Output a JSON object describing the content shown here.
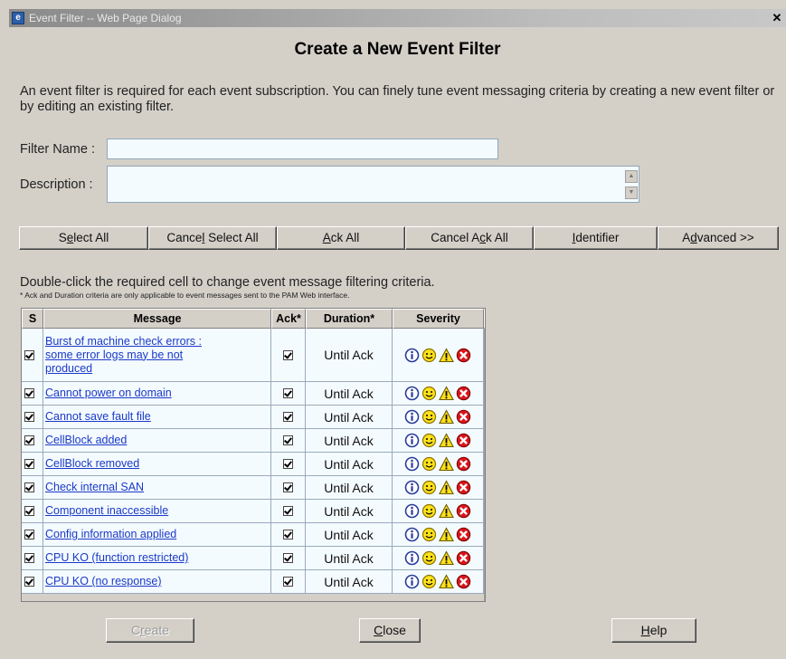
{
  "window": {
    "title": "Event Filter -- Web Page Dialog",
    "close_glyph": "✕"
  },
  "page": {
    "heading": "Create a New Event Filter",
    "intro": "An event filter is required for each event subscription. You can finely tune event messaging criteria by creating a new event filter or by editing an existing filter."
  },
  "form": {
    "filter_name_label": "Filter Name :",
    "filter_name_value": "",
    "description_label": "Description :",
    "description_value": ""
  },
  "toolbar": [
    {
      "pre": "S",
      "key": "e",
      "post": "lect All",
      "name": "select-all-button"
    },
    {
      "pre": "Cance",
      "key": "l",
      "post": " Select All",
      "name": "cancel-select-all-button"
    },
    {
      "pre": "",
      "key": "A",
      "post": "ck All",
      "name": "ack-all-button"
    },
    {
      "pre": "Cancel A",
      "key": "c",
      "post": "k All",
      "name": "cancel-ack-all-button"
    },
    {
      "pre": "",
      "key": "I",
      "post": "dentifier",
      "name": "identifier-button"
    },
    {
      "pre": "A",
      "key": "d",
      "post": "vanced >>",
      "name": "advanced-button"
    }
  ],
  "instructions": "Double-click the required cell to change event message filtering criteria.",
  "note": "* Ack and Duration criteria are only applicable to event messages sent to the PAM Web interface.",
  "table": {
    "columns": [
      "S",
      "Message",
      "Ack*",
      "Duration*",
      "Severity"
    ],
    "rows": [
      {
        "selected": true,
        "message": "Burst of machine check errors : some error logs may be not produced",
        "ack": true,
        "duration": "Until Ack"
      },
      {
        "selected": true,
        "message": "Cannot power on domain",
        "ack": true,
        "duration": "Until Ack"
      },
      {
        "selected": true,
        "message": "Cannot save fault file",
        "ack": true,
        "duration": "Until Ack"
      },
      {
        "selected": true,
        "message": "CellBlock added",
        "ack": true,
        "duration": "Until Ack"
      },
      {
        "selected": true,
        "message": "CellBlock removed",
        "ack": true,
        "duration": "Until Ack"
      },
      {
        "selected": true,
        "message": "Check internal SAN",
        "ack": true,
        "duration": "Until Ack"
      },
      {
        "selected": true,
        "message": "Component inaccessible",
        "ack": true,
        "duration": "Until Ack"
      },
      {
        "selected": true,
        "message": "Config information applied",
        "ack": true,
        "duration": "Until Ack"
      },
      {
        "selected": true,
        "message": "CPU KO (function restricted)",
        "ack": true,
        "duration": "Until Ack"
      },
      {
        "selected": true,
        "message": "CPU KO (no response)",
        "ack": true,
        "duration": "Until Ack"
      }
    ],
    "severity_icons": [
      "info-icon",
      "success-icon",
      "warning-icon",
      "error-icon"
    ]
  },
  "footer": [
    {
      "pre": "C",
      "key": "r",
      "post": "eate",
      "name": "create-button",
      "disabled": true
    },
    {
      "pre": "",
      "key": "C",
      "post": "lose",
      "name": "close-button",
      "disabled": false
    },
    {
      "pre": "",
      "key": "H",
      "post": "elp",
      "name": "help-button",
      "disabled": false
    }
  ],
  "colors": {
    "dialog_bg": "#d4d0c8",
    "link": "#1a39c8",
    "field_bg": "#f4fbff"
  }
}
